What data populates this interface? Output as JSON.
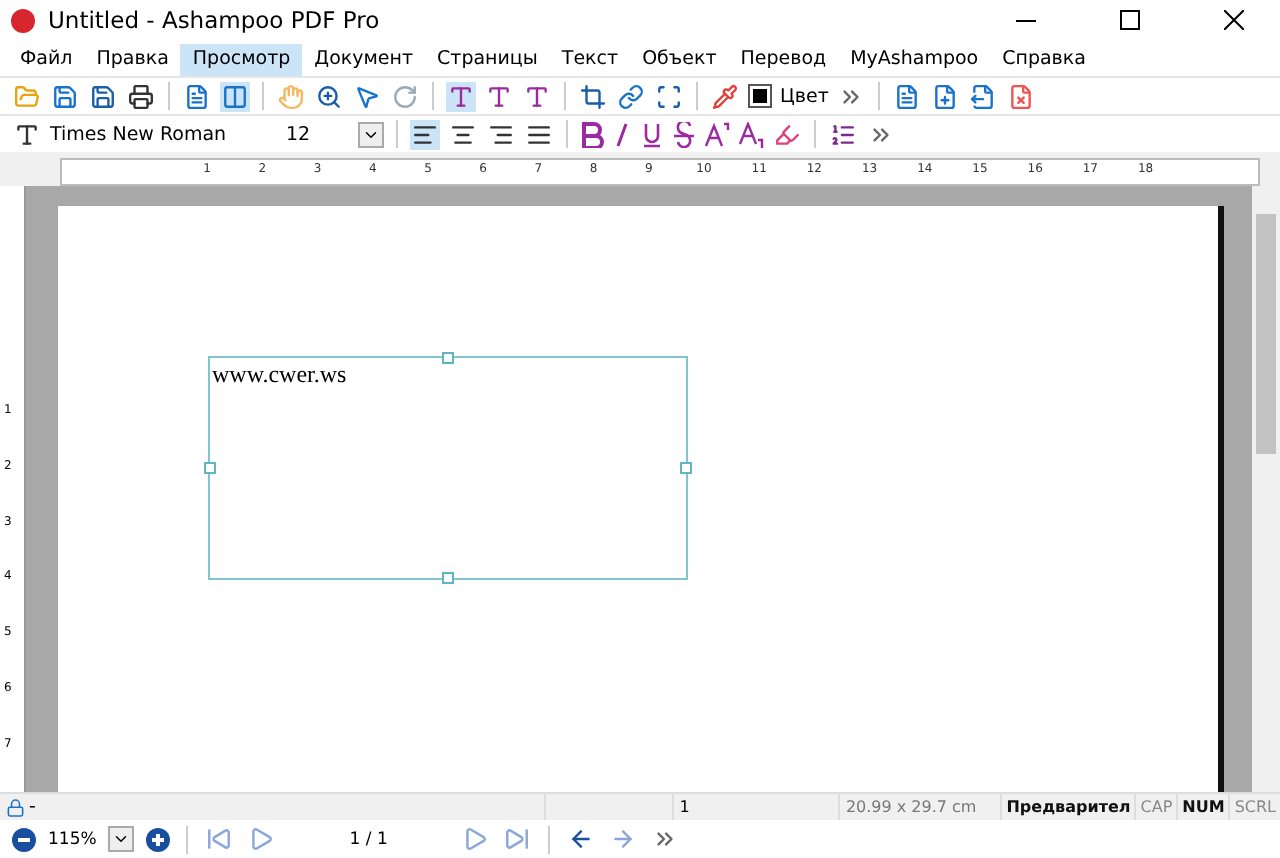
{
  "window": {
    "title": "Untitled - Ashampoo PDF Pro"
  },
  "menu": [
    {
      "label": "Файл",
      "selected": false
    },
    {
      "label": "Правка",
      "selected": false
    },
    {
      "label": "Просмотр",
      "selected": true
    },
    {
      "label": "Документ",
      "selected": false
    },
    {
      "label": "Страницы",
      "selected": false
    },
    {
      "label": "Текст",
      "selected": false
    },
    {
      "label": "Объект",
      "selected": false
    },
    {
      "label": "Перевод",
      "selected": false
    },
    {
      "label": "MyAshampoo",
      "selected": false
    },
    {
      "label": "Справка",
      "selected": false
    }
  ],
  "toolbar": {
    "color_label": "Цвет"
  },
  "format_bar": {
    "font": "Times New Roman",
    "size": "12"
  },
  "ruler": {
    "horizontal": [
      "1",
      "2",
      "3",
      "4",
      "5",
      "6",
      "7",
      "8",
      "9",
      "10",
      "11",
      "12",
      "13",
      "14",
      "15",
      "16",
      "17",
      "18"
    ],
    "vertical": [
      "1",
      "2",
      "3",
      "4",
      "5",
      "6",
      "7"
    ]
  },
  "document": {
    "text_box": "www.cwer.ws"
  },
  "status_bar": {
    "lock": "-",
    "page": "1",
    "size": "20.99 x 29.7 cm",
    "indicators": [
      {
        "label": "Предварител",
        "on": true
      },
      {
        "label": "CAP",
        "on": false
      },
      {
        "label": "NUM",
        "on": true
      },
      {
        "label": "SCRL",
        "on": false
      }
    ]
  },
  "nav_bar": {
    "zoom": "115%",
    "pages": "1 / 1"
  }
}
